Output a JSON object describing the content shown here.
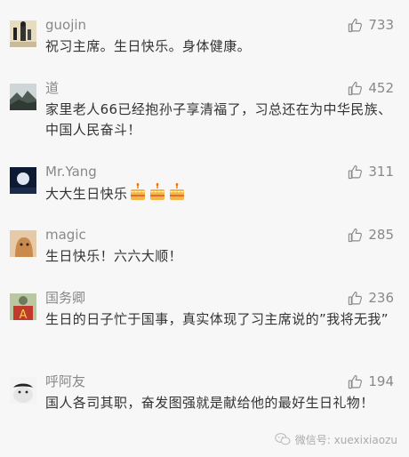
{
  "comments": [
    {
      "user": "guojin",
      "likes": "733",
      "text": "祝习主席。生日快乐。身体健康。"
    },
    {
      "user": "道",
      "likes": "452",
      "text": "家里老人66已经抱孙子享清福了，习总还在为中华民族、中国人民奋斗！"
    },
    {
      "user": "Mr.Yang",
      "likes": "311",
      "text": "大大生日快乐"
    },
    {
      "user": "magic",
      "likes": "285",
      "text": "生日快乐！六六大顺！"
    },
    {
      "user": "国务卿",
      "likes": "236",
      "text": "生日的日子忙于国事，真实体现了习主席说的”我将无我”"
    },
    {
      "user": "呼阿友",
      "likes": "194",
      "text": "国人各司其职，奋发图强就是献给他的最好生日礼物！"
    }
  ],
  "icons": {
    "like": "thumbs-up-icon",
    "cake": "birthday-cake-emoji",
    "watermark": "wechat-icon"
  },
  "watermark": {
    "text": "微信号: xuexixiaozu"
  }
}
